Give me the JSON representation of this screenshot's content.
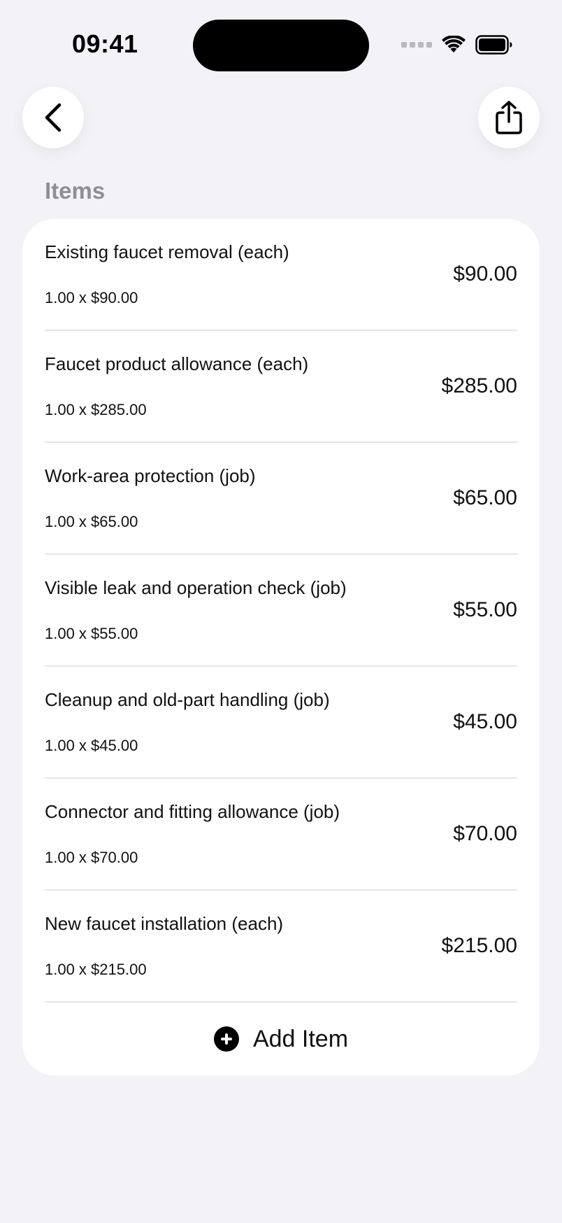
{
  "status_bar": {
    "time": "09:41"
  },
  "nav": {
    "back_icon": "chevron-left-icon",
    "share_icon": "share-icon"
  },
  "section": {
    "title": "Items"
  },
  "items": [
    {
      "name": "Existing faucet removal (each)",
      "detail": "1.00 x $90.00",
      "price": "$90.00"
    },
    {
      "name": "Faucet product allowance (each)",
      "detail": "1.00 x $285.00",
      "price": "$285.00"
    },
    {
      "name": "Work-area protection (job)",
      "detail": "1.00 x $65.00",
      "price": "$65.00"
    },
    {
      "name": "Visible leak and operation check (job)",
      "detail": "1.00 x $55.00",
      "price": "$55.00"
    },
    {
      "name": "Cleanup and old-part handling (job)",
      "detail": "1.00 x $45.00",
      "price": "$45.00"
    },
    {
      "name": "Connector and fitting allowance (job)",
      "detail": "1.00 x $70.00",
      "price": "$70.00"
    },
    {
      "name": "New faucet installation (each)",
      "detail": "1.00 x $215.00",
      "price": "$215.00"
    }
  ],
  "add_item": {
    "label": "Add Item",
    "icon": "plus-circle-icon"
  }
}
